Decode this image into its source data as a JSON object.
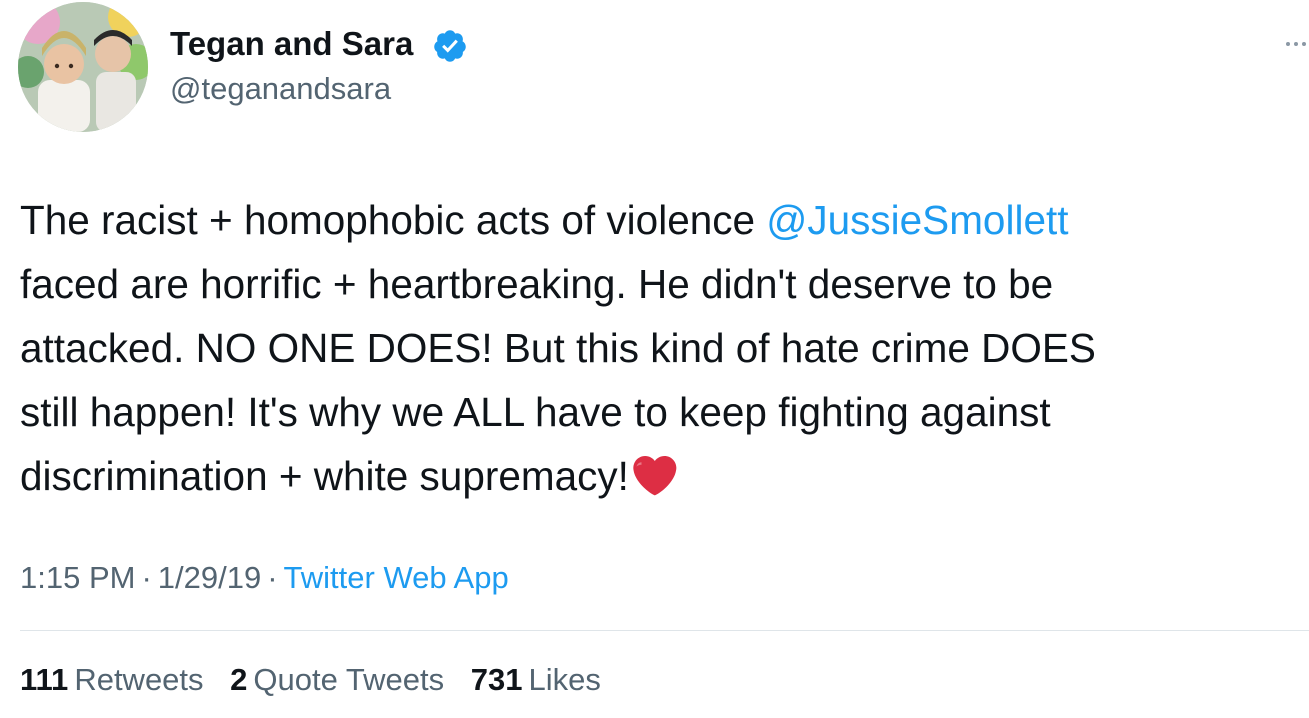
{
  "author": {
    "display_name": "Tegan and Sara",
    "handle": "@teganandsara",
    "verified": true,
    "verified_color": "#1d9bf0"
  },
  "tweet": {
    "text_before_mention": "The racist + homophobic acts of violence  ",
    "mention": "@JussieSmollett",
    "text_after_mention": "faced are horrific + heartbreaking.  He didn't deserve to be\nattacked.  NO ONE DOES! But this kind of hate crime DOES\nstill happen! It's why we ALL have to keep fighting against\ndiscrimination + white supremacy!",
    "emoji": "heart-emoji"
  },
  "meta": {
    "time": "1:15 PM",
    "separator": "·",
    "date": "1/29/19",
    "source": "Twitter Web App"
  },
  "stats": {
    "retweets_count": "111",
    "retweets_label": "Retweets",
    "quotes_count": "2",
    "quotes_label": "Quote Tweets",
    "likes_count": "731",
    "likes_label": "Likes"
  },
  "colors": {
    "text": "#0f1419",
    "secondary": "#536471",
    "link": "#1d9bf0",
    "heart": "#e0245e"
  }
}
